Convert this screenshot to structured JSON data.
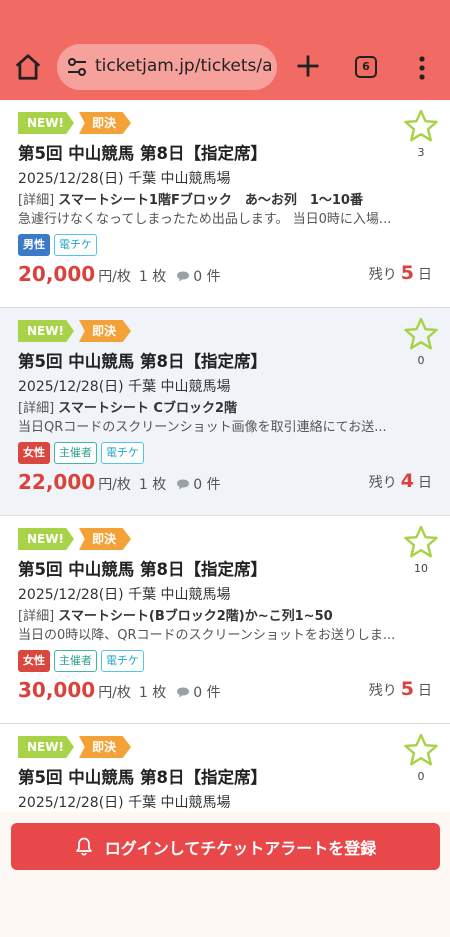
{
  "browser": {
    "url": "ticketjam.jp/tickets/a",
    "tab_count": "6"
  },
  "badges": {
    "new": "NEW!",
    "sokketsu": "即決"
  },
  "listings": [
    {
      "title": "第5回 中山競馬 第8日【指定席】",
      "date": "2025/12/28(日) 千葉 中山競馬場",
      "detail_label": "[詳細]",
      "seat": "スマートシート1階Fブロック　あ〜お列　1〜10番",
      "description": "急遽行けなくなってしまったため出品します。 当日0時に入場...",
      "tags": [
        {
          "label": "男性",
          "type": "male"
        },
        {
          "label": "電チケ",
          "type": "eticket"
        }
      ],
      "price": "20,000",
      "unit": "円/枚",
      "qty": "1 枚",
      "comments": "0 件",
      "remain_label": "残り",
      "remain_num": "5",
      "remain_unit": "日",
      "fav_count": "3"
    },
    {
      "title": "第5回 中山競馬 第8日【指定席】",
      "date": "2025/12/28(日) 千葉 中山競馬場",
      "detail_label": "[詳細]",
      "seat": "スマートシート Cブロック2階",
      "description": "当日QRコードのスクリーンショット画像を取引連絡にてお送...",
      "tags": [
        {
          "label": "女性",
          "type": "female"
        },
        {
          "label": "主催者",
          "type": "host"
        },
        {
          "label": "電チケ",
          "type": "eticket"
        }
      ],
      "price": "22,000",
      "unit": "円/枚",
      "qty": "1 枚",
      "comments": "0 件",
      "remain_label": "残り",
      "remain_num": "4",
      "remain_unit": "日",
      "fav_count": "0"
    },
    {
      "title": "第5回 中山競馬 第8日【指定席】",
      "date": "2025/12/28(日) 千葉 中山競馬場",
      "detail_label": "[詳細]",
      "seat": "スマートシート(Bブロック2階)か~こ列1~50",
      "description": "当日の0時以降、QRコードのスクリーンショットをお送りしま...",
      "tags": [
        {
          "label": "女性",
          "type": "female"
        },
        {
          "label": "主催者",
          "type": "host"
        },
        {
          "label": "電チケ",
          "type": "eticket"
        }
      ],
      "price": "30,000",
      "unit": "円/枚",
      "qty": "1 枚",
      "comments": "0 件",
      "remain_label": "残り",
      "remain_num": "5",
      "remain_unit": "日",
      "fav_count": "10"
    },
    {
      "title": "第5回 中山競馬 第8日【指定席】",
      "date": "2025/12/28(日) 千葉 中山競馬場",
      "fav_count": "0"
    }
  ],
  "footer": {
    "login_button": "ログインしてチケットアラートを登録"
  },
  "icons": {
    "home": "home-icon",
    "site_settings": "tune-icon",
    "new_tab": "plus-icon",
    "menu": "more-vert-icon",
    "favorite": "star-outline-icon",
    "comment": "speech-bubble-icon",
    "alert": "bell-icon"
  },
  "colors": {
    "header": "#f26a64",
    "accent_red": "#d9433b",
    "new_badge": "#a8d247",
    "sokketsu_badge": "#f3a238",
    "star": "#a8d247",
    "login_button": "#e8484a"
  }
}
